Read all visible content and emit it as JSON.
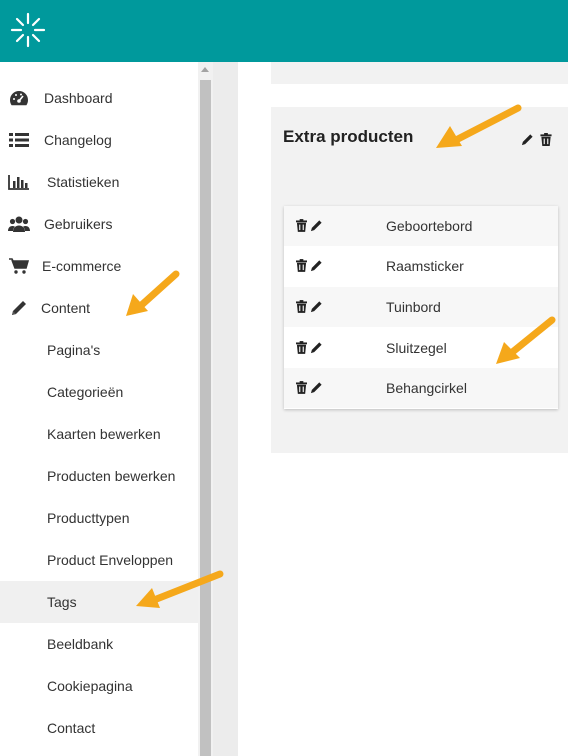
{
  "colors": {
    "topbar": "#00999c",
    "arrow": "#f5a81b"
  },
  "topbar": {
    "logo_icon": "sunburst-logo-icon"
  },
  "sidebar": {
    "items": [
      {
        "label": "Dashboard",
        "icon": "dashboard-gauge-icon"
      },
      {
        "label": "Changelog",
        "icon": "list-icon"
      },
      {
        "label": "Statistieken",
        "icon": "bar-chart-icon"
      },
      {
        "label": "Gebruikers",
        "icon": "users-icon"
      },
      {
        "label": "E-commerce",
        "icon": "shopping-cart-icon"
      },
      {
        "label": "Content",
        "icon": "pencil-icon"
      }
    ],
    "subitems": [
      {
        "label": "Pagina's"
      },
      {
        "label": "Categorieën"
      },
      {
        "label": "Kaarten bewerken"
      },
      {
        "label": "Producten bewerken"
      },
      {
        "label": "Producttypen"
      },
      {
        "label": "Product Enveloppen"
      },
      {
        "label": "Tags",
        "active": true
      },
      {
        "label": "Beeldbank"
      },
      {
        "label": "Cookiepagina"
      },
      {
        "label": "Contact"
      }
    ]
  },
  "panel": {
    "title": "Extra producten",
    "rows": [
      {
        "name": "Geboortebord"
      },
      {
        "name": "Raamsticker"
      },
      {
        "name": "Tuinbord"
      },
      {
        "name": "Sluitzegel"
      },
      {
        "name": "Behangcirkel"
      }
    ]
  }
}
